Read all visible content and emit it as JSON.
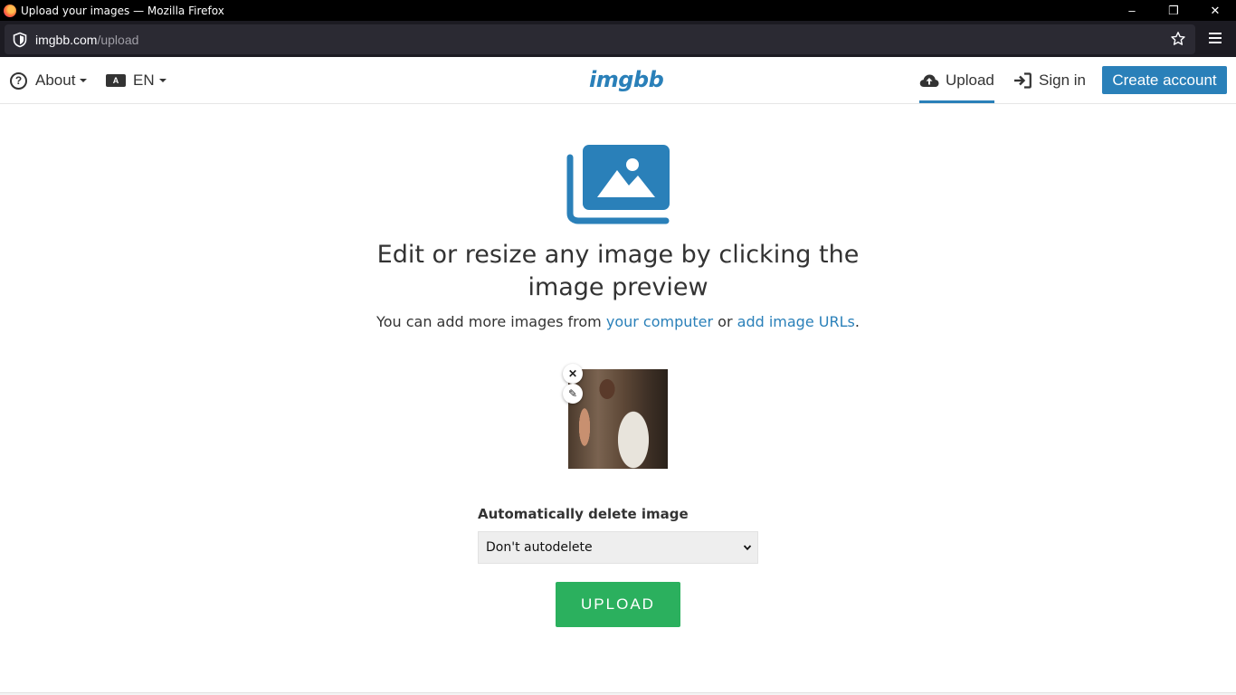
{
  "browser": {
    "window_title": "Upload your images — Mozilla Firefox",
    "url_host": "imgbb.com",
    "url_path": "/upload",
    "controls": {
      "minimize": "–",
      "restore": "❐",
      "close": "✕"
    }
  },
  "header": {
    "about_label": "About",
    "lang_icon_text": "A",
    "lang_label": "EN",
    "logo": "imgbb",
    "upload_label": "Upload",
    "signin_label": "Sign in",
    "create_account_label": "Create account"
  },
  "main": {
    "headline": "Edit or resize any image by clicking the image preview",
    "sub_prefix": "You can add more images from ",
    "link_computer": "your computer",
    "sub_middle": " or ",
    "link_urls": "add image URLs",
    "sub_suffix": ".",
    "thumb_close": "✕",
    "thumb_edit": "✎",
    "autodelete_label": "Automatically delete image",
    "autodelete_value": "Don't autodelete",
    "upload_button": "UPLOAD"
  },
  "colors": {
    "accent": "#2a80b9",
    "upload_green": "#2bb05e",
    "titlebar": "#000000",
    "urlbar": "#1c1b22"
  }
}
